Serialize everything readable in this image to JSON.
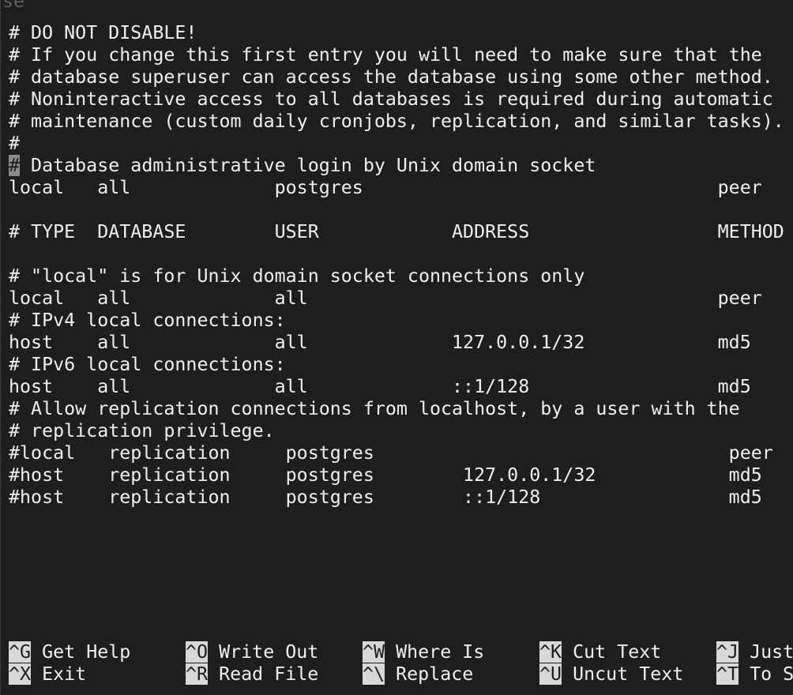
{
  "window": {
    "title_fragment": "se"
  },
  "editor": {
    "lines": [
      "# DO NOT DISABLE!",
      "# If you change this first entry you will need to make sure that the",
      "# database superuser can access the database using some other method.",
      "# Noninteractive access to all databases is required during automatic",
      "# maintenance (custom daily cronjobs, replication, and similar tasks).",
      "#",
      "",
      "local   all             postgres                                peer",
      "",
      "# TYPE  DATABASE        USER            ADDRESS                 METHOD",
      "",
      "# \"local\" is for Unix domain socket connections only",
      "local   all             all                                     peer",
      "# IPv4 local connections:",
      "host    all             all             127.0.0.1/32            md5",
      "# IPv6 local connections:",
      "host    all             all             ::1/128                 md5",
      "# Allow replication connections from localhost, by a user with the",
      "# replication privilege.",
      "#local   replication     postgres                                peer",
      "#host    replication     postgres        127.0.0.1/32            md5",
      "#host    replication     postgres        ::1/128                 md5"
    ],
    "cursor_line": {
      "cursor_char": "#",
      "rest": " Database administrative login by Unix domain socket"
    }
  },
  "shortcuts": {
    "row1": [
      {
        "key": "^G",
        "label": " Get Help"
      },
      {
        "key": "^O",
        "label": " Write Out"
      },
      {
        "key": "^W",
        "label": " Where Is"
      },
      {
        "key": "^K",
        "label": " Cut Text"
      },
      {
        "key": "^J",
        "label": " Just"
      }
    ],
    "row2": [
      {
        "key": "^X",
        "label": " Exit"
      },
      {
        "key": "^R",
        "label": " Read File"
      },
      {
        "key": "^\\",
        "label": " Replace"
      },
      {
        "key": "^U",
        "label": " Uncut Text"
      },
      {
        "key": "^T",
        "label": " To S"
      }
    ]
  }
}
